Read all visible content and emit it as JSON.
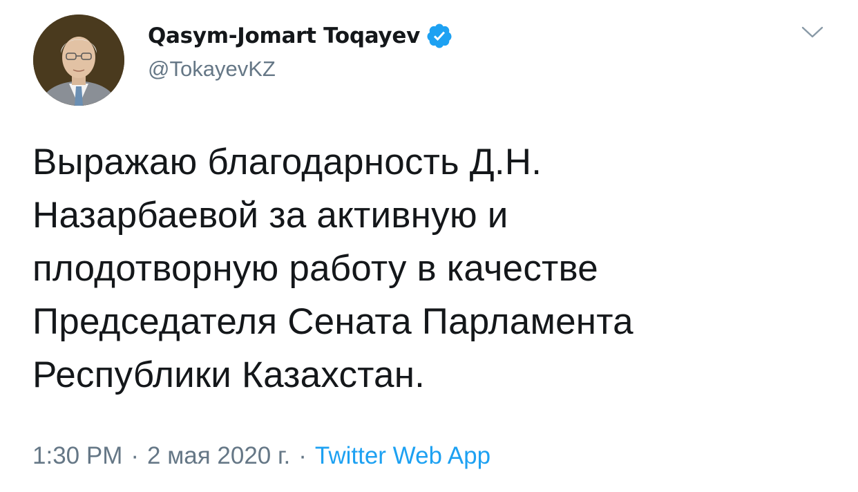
{
  "tweet": {
    "author": {
      "name": "Qasym-Jomart Toqayev",
      "handle": "@TokayevKZ",
      "verified": true,
      "avatar_icon": "profile-photo"
    },
    "text": "Выражаю благодарность Д.Н.\nНазарбаевой за активную и\nплодотворную работу в качестве\nПредседателя Сената Парламента\nРеспублики Казахстан.",
    "time": "1:30 PM",
    "date": "2 мая 2020 г.",
    "separator": "·",
    "source": "Twitter Web App",
    "menu_icon": "chevron-down-icon"
  },
  "colors": {
    "text": "#14171a",
    "secondary": "#657786",
    "accent": "#1da1f2"
  }
}
